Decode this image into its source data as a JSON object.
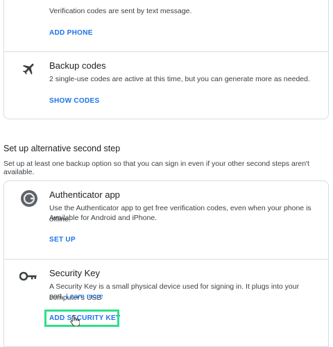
{
  "phone": {
    "description": "Verification codes are sent by text message.",
    "action": "ADD PHONE"
  },
  "backup_codes": {
    "icon": "airplane-icon",
    "title": "Backup codes",
    "description": "2 single-use codes are active at this time, but you can generate more as needed.",
    "action": "SHOW CODES"
  },
  "section": {
    "title": "Set up alternative second step",
    "description": "Set up at least one backup option so that you can sign in even if your other second steps aren't available."
  },
  "authenticator": {
    "icon": "authenticator-app-icon",
    "title": "Authenticator app",
    "description_line1": "Use the Authenticator app to get free verification codes, even when your phone is offline.",
    "description_line2": "Available for Android and iPhone.",
    "action": "SET UP"
  },
  "security_key": {
    "icon": "key-icon",
    "title": "Security Key",
    "description_line1": "A Security Key is a small physical device used for signing in. It plugs into your computer's USB",
    "description_line2": "port.",
    "learn_more": "Learn more",
    "action": "ADD SECURITY KEY"
  },
  "colors": {
    "accent": "#1a73e8",
    "highlight": "#2ee08a",
    "border": "#dadce0"
  }
}
